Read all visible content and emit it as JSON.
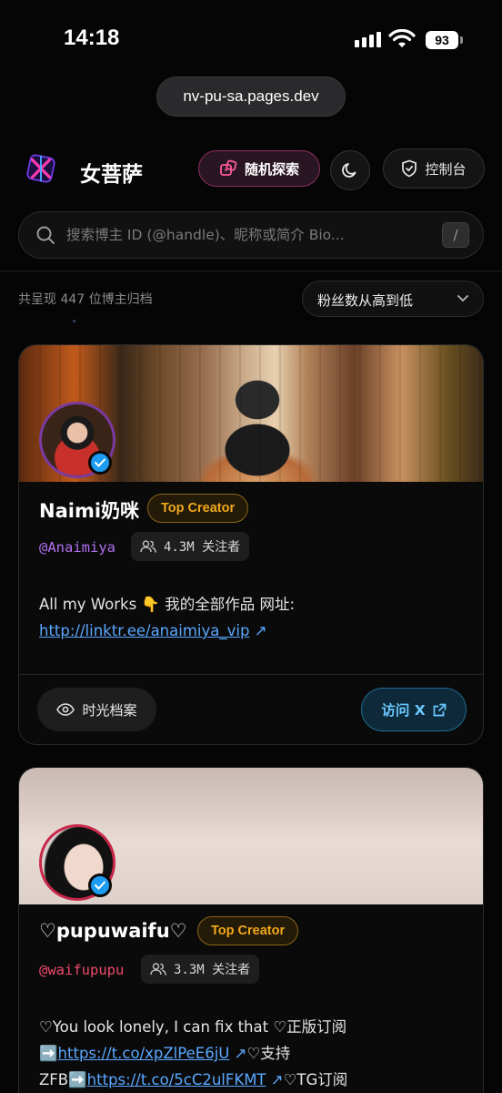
{
  "status_bar": {
    "time": "14:18",
    "battery": "93"
  },
  "browser": {
    "url": "nv-pu-sa.pages.dev"
  },
  "header": {
    "brand": "女菩萨",
    "random_label": "随机探索",
    "console_label": "控制台",
    "icons": [
      "logo-icon",
      "dice-icon",
      "moon-icon",
      "shield-icon"
    ]
  },
  "search": {
    "placeholder": "搜索博主 ID (@handle)、昵称或简介 Bio...",
    "shortcut": "/"
  },
  "list": {
    "count_text": "共呈现 447 位博主归档",
    "sort_value": "粉丝数从高到低"
  },
  "cards": [
    {
      "name": "Naimi奶咪",
      "badge": "Top Creator",
      "handle": "@Anaimiya",
      "followers": "4.3M 关注者",
      "bio_text": "All my Works 👇 我的全部作品 网址:",
      "bio_link": "http://linktr.ee/anaimiya_vip",
      "archive_label": "时光档案",
      "visit_label": "访问 X"
    },
    {
      "name": "♡pupuwaifu♡",
      "badge": "Top Creator",
      "handle": "@waifupupu",
      "followers": "3.3M 关注者",
      "bio_line1": "♡You look lonely, I can fix that ♡正版订阅",
      "bio_link1": "https://t.co/xpZlPeE6jU",
      "bio_after1": "♡支持",
      "bio_prefix2": "ZFB",
      "bio_link2": "https://t.co/5cC2ulFKMT",
      "bio_after2": "♡TG订阅"
    }
  ],
  "colors": {
    "accent_pink": "#8a2e5e",
    "gold": "#f0a81c",
    "link": "#5aa8ff",
    "handle_purple": "#b070f0",
    "handle_red": "#f04a6a",
    "verified": "#1d9bf0"
  }
}
